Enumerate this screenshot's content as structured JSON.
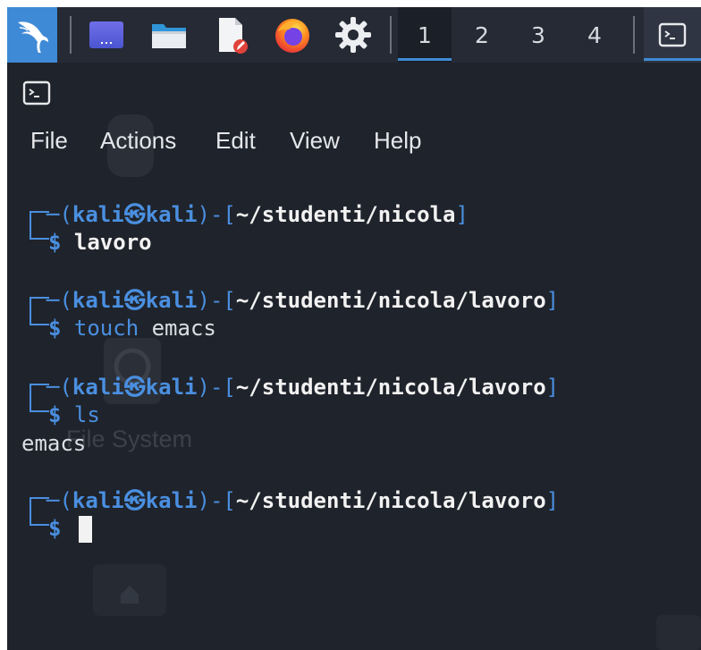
{
  "panel": {
    "workspaces": [
      "1",
      "2",
      "3",
      "4"
    ],
    "active_workspace": "1",
    "launchers": [
      "kali-menu",
      "show-desktop",
      "file-manager",
      "text-editor",
      "firefox",
      "settings"
    ]
  },
  "terminal": {
    "menu": [
      "File",
      "Actions",
      "Edit",
      "View",
      "Help"
    ],
    "background_ghost_label": "File System",
    "prompts": [
      {
        "user": "kali",
        "host": "kali",
        "path": "~/studenti/nicola",
        "command_name": "",
        "command_args": "lavoro",
        "output": ""
      },
      {
        "user": "kali",
        "host": "kali",
        "path": "~/studenti/nicola/lavoro",
        "command_name": "touch",
        "command_args": "emacs",
        "output": ""
      },
      {
        "user": "kali",
        "host": "kali",
        "path": "~/studenti/nicola/lavoro",
        "command_name": "ls",
        "command_args": "",
        "output": "emacs"
      },
      {
        "user": "kali",
        "host": "kali",
        "path": "~/studenti/nicola/lavoro",
        "command_name": "",
        "command_args": "",
        "output": ""
      }
    ],
    "prompt_symbol": "$",
    "at_symbol": "㉿"
  },
  "colors": {
    "panel_bg": "#252a35",
    "accent": "#3f8ad6",
    "terminal_bg": "#1f232b",
    "prompt_blue": "#4a8fe0"
  }
}
